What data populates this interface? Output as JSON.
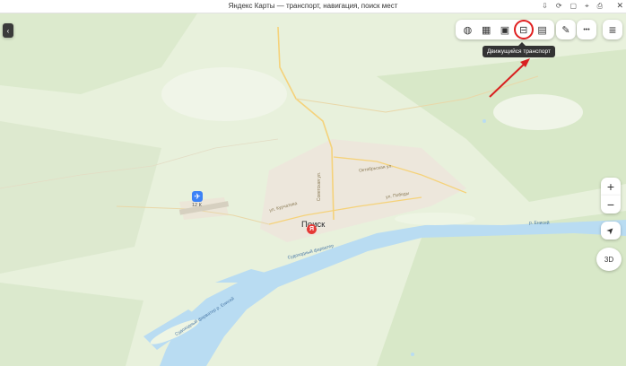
{
  "window": {
    "title": "Яндекс Карты — транспорт, навигация, поиск мест"
  },
  "toolbar": {
    "buttons": [
      {
        "name": "layers-icon",
        "glyph": "◍"
      },
      {
        "name": "traffic-icon",
        "glyph": "▦"
      },
      {
        "name": "panorama-icon",
        "glyph": "▣"
      },
      {
        "name": "transit-icon",
        "glyph": "⊟"
      },
      {
        "name": "parking-icon",
        "glyph": "▤"
      }
    ],
    "tooltip": "Движущийся транспорт",
    "ruler_glyph": "✎",
    "more_glyph": "•••",
    "menu_glyph": "≡"
  },
  "map": {
    "city": "Поиск",
    "airport_label": "12 К",
    "streets": [
      "ул. Курчатова",
      "Октябрьская ул.",
      "ул. Победы",
      "Советская ул."
    ],
    "water_labels": [
      "Судоходный фарватер",
      "Судоходный фарватер р. Енисей",
      "р. Енисей"
    ]
  },
  "controls": {
    "zoom_in": "+",
    "zoom_out": "−",
    "locate_glyph": "➤",
    "view_3d": "3D"
  },
  "colors": {
    "land": "#e8f1dc",
    "forest": "#d7e8c7",
    "water": "#b9dcf2",
    "city": "#ede7dc",
    "road": "#f5d27a",
    "highlight": "#e02020",
    "annotation_arrow": "#d82020"
  }
}
